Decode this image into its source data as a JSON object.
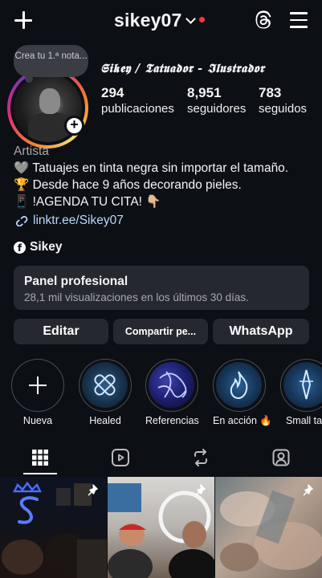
{
  "header": {
    "username": "sikey07",
    "icons": [
      "plus-icon",
      "chevron-down-icon",
      "threads-icon",
      "menu-icon"
    ]
  },
  "note": {
    "text": "Crea tu 1.ª nota..."
  },
  "profile": {
    "display_name": "𝕾𝖎𝖐𝖊𝖞 / 𝕿𝖆𝖙𝖚𝖆𝖉𝖔𝖗 - 𝕴𝖑𝖚𝖘𝖙𝖗𝖆𝖉𝖔𝖗",
    "stats": [
      {
        "value": "294",
        "label": "publicaciones"
      },
      {
        "value": "8,951",
        "label": "seguidores"
      },
      {
        "value": "783",
        "label": "seguidos"
      }
    ]
  },
  "bio": {
    "category": "Artista",
    "lines": [
      "🩶 Tatuajes en tinta negra sin importar el tamaño.",
      "🏆 Desde hace 9 años decorando pieles.",
      "📱 !AGENDA TU CITA! 👇🏼"
    ],
    "link": "linktr.ee/Sikey07",
    "facebook": "Sikey"
  },
  "pro_panel": {
    "title": "Panel profesional",
    "subtitle": "28,1 mil visualizaciones en los últimos 30 días."
  },
  "buttons": {
    "edit": "Editar",
    "share": "Compartir pe...",
    "whatsapp": "WhatsApp"
  },
  "highlights": [
    {
      "label": "Nueva"
    },
    {
      "label": "Healed"
    },
    {
      "label": "Referencias"
    },
    {
      "label": "En acción 🔥"
    },
    {
      "label": "Small tatt"
    }
  ],
  "tabs": [
    "grid-icon",
    "reels-icon",
    "reposts-icon",
    "tagged-icon"
  ],
  "colors": {
    "background": "#0c0f14",
    "panel": "#25292f",
    "notification_dot": "#ff3040",
    "link": "#b9d9ff"
  }
}
